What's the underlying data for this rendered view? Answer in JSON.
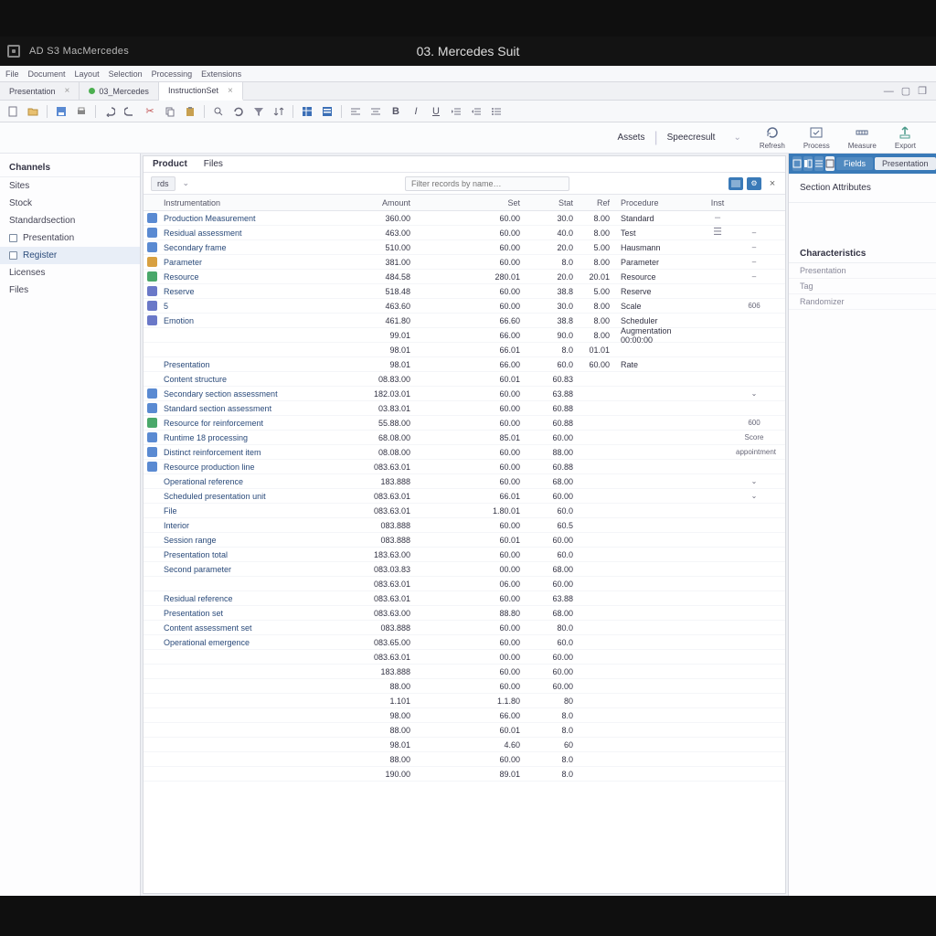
{
  "app": {
    "title": "AD S3 MacMercedes",
    "document_title": "03. Mercedes Suit"
  },
  "menubar": {
    "items": [
      "File",
      "Document",
      "Layout",
      "Selection",
      "Processing",
      "Extensions"
    ]
  },
  "tabs": [
    {
      "label": "Presentation",
      "active": false,
      "dot": "green"
    },
    {
      "label": "03_Mercedes",
      "active": true,
      "dot": ""
    },
    {
      "label": "InstructionSet",
      "active": false,
      "dot": ""
    }
  ],
  "secondary": {
    "links": [
      "Assets",
      "Speecresult"
    ],
    "buttons": [
      "Refresh",
      "Process",
      "Measure",
      "Export"
    ]
  },
  "sidebar": {
    "header": "Channels",
    "items": [
      {
        "label": "Sites"
      },
      {
        "label": "Stock"
      },
      {
        "label": "Standardsection"
      },
      {
        "label": "Presentation",
        "checkbox": true
      },
      {
        "label": "Register",
        "checkbox": true,
        "selected": true
      },
      {
        "label": "Licenses"
      },
      {
        "label": "Files"
      }
    ]
  },
  "main": {
    "tabs": [
      "Product",
      "Files"
    ],
    "filter_chip": "rds",
    "filter_placeholder": "Filter records by name…",
    "columns": [
      "",
      "Instrumentation",
      "Amount",
      "Set",
      "Stat",
      "Ref",
      "Procedure",
      "Inst",
      ""
    ],
    "rows": [
      {
        "ico": "#5a8ad2",
        "name": "Production Measurement",
        "a": "360.00",
        "b": "60.00",
        "c": "30.0",
        "d": "8.00",
        "e": "Standard",
        "f": "–",
        "act": ""
      },
      {
        "ico": "#5a8ad2",
        "name": "Residual assessment",
        "a": "463.00",
        "b": "60.00",
        "c": "40.0",
        "d": "8.00",
        "e": "Test",
        "f": "☰",
        "act": "–"
      },
      {
        "ico": "#5a8ad2",
        "name": "Secondary frame",
        "a": "510.00",
        "b": "60.00",
        "c": "20.0",
        "d": "5.00",
        "e": "Hausmann",
        "f": "",
        "act": "–"
      },
      {
        "ico": "#d8a040",
        "name": "Parameter",
        "a": "381.00",
        "b": "60.00",
        "c": "8.0",
        "d": "8.00",
        "e": "Parameter",
        "f": "",
        "act": "–"
      },
      {
        "ico": "#4aa86a",
        "name": "Resource",
        "a": "484.58",
        "b": "280.01",
        "c": "20.0",
        "d": "20.01",
        "e": "Resource",
        "f": "",
        "act": "–"
      },
      {
        "ico": "#6a78c8",
        "name": "Reserve",
        "a": "518.48",
        "b": "60.00",
        "c": "38.8",
        "d": "5.00",
        "e": "Reserve",
        "f": "",
        "act": ""
      },
      {
        "ico": "#6a78c8",
        "name": "5",
        "a": "463.60",
        "b": "60.00",
        "c": "30.0",
        "d": "8.00",
        "e": "Scale",
        "f": "",
        "act": "606"
      },
      {
        "ico": "#6a78c8",
        "name": "Emotion",
        "a": "461.80",
        "b": "66.60",
        "c": "38.8",
        "d": "8.00",
        "e": "Scheduler",
        "f": "",
        "act": ""
      },
      {
        "ico": "",
        "name": "",
        "a": "99.01",
        "b": "66.00",
        "c": "90.0",
        "d": "8.00",
        "e": "Augmentation 00:00:00",
        "f": "",
        "act": ""
      },
      {
        "ico": "",
        "name": "",
        "a": "98.01",
        "b": "66.01",
        "c": "8.0",
        "d": "01.01",
        "e": "",
        "f": "",
        "act": ""
      },
      {
        "ico": "",
        "name": "Presentation",
        "a": "98.01",
        "b": "66.00",
        "c": "60.0",
        "d": "60.00",
        "e": "Rate",
        "f": "",
        "act": ""
      },
      {
        "ico": "",
        "name": "Content structure",
        "a": "08.83.00",
        "b": "60.01",
        "c": "60.83",
        "d": "",
        "e": "",
        "f": "",
        "act": ""
      },
      {
        "ico": "#5a8ad2",
        "name": "Secondary section assessment",
        "a": "182.03.01",
        "b": "60.00",
        "c": "63.88",
        "d": "",
        "e": "",
        "f": "",
        "act": "⌄"
      },
      {
        "ico": "#5a8ad2",
        "name": "Standard section assessment",
        "a": "03.83.01",
        "b": "60.00",
        "c": "60.88",
        "d": "",
        "e": "",
        "f": "",
        "act": ""
      },
      {
        "ico": "#4aa86a",
        "name": "Resource for reinforcement",
        "a": "55.88.00",
        "b": "60.00",
        "c": "60.88",
        "d": "",
        "e": "",
        "f": "",
        "act": "600"
      },
      {
        "ico": "#5a8ad2",
        "name": "Runtime 18 processing",
        "a": "68.08.00",
        "b": "85.01",
        "c": "60.00",
        "d": "",
        "e": "",
        "f": "",
        "act": "Score"
      },
      {
        "ico": "#5a8ad2",
        "name": "Distinct reinforcement item",
        "a": "08.08.00",
        "b": "60.00",
        "c": "88.00",
        "d": "",
        "e": "",
        "f": "",
        "act": "appointment"
      },
      {
        "ico": "#5a8ad2",
        "name": "Resource production line",
        "a": "083.63.01",
        "b": "60.00",
        "c": "60.88",
        "d": "",
        "e": "",
        "f": "",
        "act": ""
      },
      {
        "ico": "",
        "name": "Operational reference",
        "a": "183.888",
        "b": "60.00",
        "c": "68.00",
        "d": "",
        "e": "",
        "f": "",
        "act": "⌄"
      },
      {
        "ico": "",
        "name": "Scheduled presentation unit",
        "a": "083.63.01",
        "b": "66.01",
        "c": "60.00",
        "d": "",
        "e": "",
        "f": "",
        "act": "⌄"
      },
      {
        "ico": "",
        "name": "File",
        "a": "083.63.01",
        "b": "1.80.01",
        "c": "60.0",
        "d": "",
        "e": "",
        "f": "",
        "act": ""
      },
      {
        "ico": "",
        "name": "Interior",
        "a": "083.888",
        "b": "60.00",
        "c": "60.5",
        "d": "",
        "e": "",
        "f": "",
        "act": ""
      },
      {
        "ico": "",
        "name": "Session range",
        "a": "083.888",
        "b": "60.01",
        "c": "60.00",
        "d": "",
        "e": "",
        "f": "",
        "act": ""
      },
      {
        "ico": "",
        "name": "Presentation total",
        "a": "183.63.00",
        "b": "60.00",
        "c": "60.0",
        "d": "",
        "e": "",
        "f": "",
        "act": ""
      },
      {
        "ico": "",
        "name": "Second parameter",
        "a": "083.03.83",
        "b": "00.00",
        "c": "68.00",
        "d": "",
        "e": "",
        "f": "",
        "act": ""
      },
      {
        "ico": "",
        "name": "",
        "a": "083.63.01",
        "b": "06.00",
        "c": "60.00",
        "d": "",
        "e": "",
        "f": "",
        "act": ""
      },
      {
        "ico": "",
        "name": "Residual reference",
        "a": "083.63.01",
        "b": "60.00",
        "c": "63.88",
        "d": "",
        "e": "",
        "f": "",
        "act": ""
      },
      {
        "ico": "",
        "name": "Presentation set",
        "a": "083.63.00",
        "b": "88.80",
        "c": "68.00",
        "d": "",
        "e": "",
        "f": "",
        "act": ""
      },
      {
        "ico": "",
        "name": "Content assessment set",
        "a": "083.888",
        "b": "60.00",
        "c": "80.0",
        "d": "",
        "e": "",
        "f": "",
        "act": ""
      },
      {
        "ico": "",
        "name": "Operational emergence",
        "a": "083.65.00",
        "b": "60.00",
        "c": "60.0",
        "d": "",
        "e": "",
        "f": "",
        "act": ""
      },
      {
        "ico": "",
        "name": "",
        "a": "083.63.01",
        "b": "00.00",
        "c": "60.00",
        "d": "",
        "e": "",
        "f": "",
        "act": ""
      },
      {
        "ico": "",
        "name": "",
        "a": "183.888",
        "b": "60.00",
        "c": "60.00",
        "d": "",
        "e": "",
        "f": "",
        "act": ""
      },
      {
        "ico": "",
        "name": "",
        "a": "88.00",
        "b": "60.00",
        "c": "60.00",
        "d": "",
        "e": "",
        "f": "",
        "act": ""
      },
      {
        "ico": "",
        "name": "",
        "a": "1.101",
        "b": "1.1.80",
        "c": "80",
        "d": "",
        "e": "",
        "f": "",
        "act": ""
      },
      {
        "ico": "",
        "name": "",
        "a": "98.00",
        "b": "66.00",
        "c": "8.0",
        "d": "",
        "e": "",
        "f": "",
        "act": ""
      },
      {
        "ico": "",
        "name": "",
        "a": "88.00",
        "b": "60.01",
        "c": "8.0",
        "d": "",
        "e": "",
        "f": "",
        "act": ""
      },
      {
        "ico": "",
        "name": "",
        "a": "98.01",
        "b": "4.60",
        "c": "60",
        "d": "",
        "e": "",
        "f": "",
        "act": ""
      },
      {
        "ico": "",
        "name": "",
        "a": "88.00",
        "b": "60.00",
        "c": "8.0",
        "d": "",
        "e": "",
        "f": "",
        "act": ""
      },
      {
        "ico": "",
        "name": "",
        "a": "190.00",
        "b": "89.01",
        "c": "8.0",
        "d": "",
        "e": "",
        "f": "",
        "act": ""
      }
    ]
  },
  "inspector": {
    "view_label": "Fields",
    "more_label": "Presentation",
    "section_title": "Section Attributes",
    "group": "Characteristics",
    "props": [
      "Presentation",
      "Tag",
      "Randomizer"
    ]
  }
}
